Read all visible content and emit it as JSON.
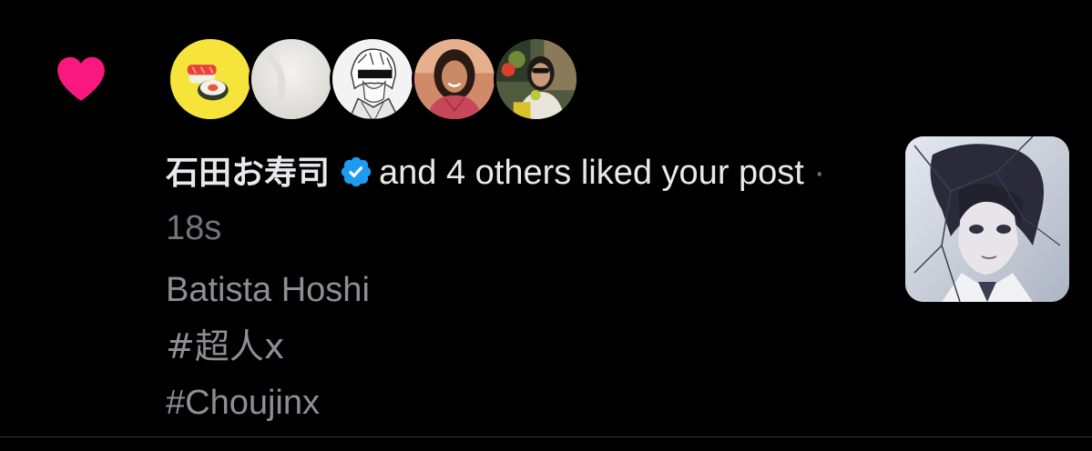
{
  "notification": {
    "type_icon": "heart-icon",
    "accent_color": "#f91880",
    "avatars": [
      {
        "name": "avatar-sushi",
        "icon": "sushi-icon"
      },
      {
        "name": "avatar-blank"
      },
      {
        "name": "avatar-manga-portrait"
      },
      {
        "name": "avatar-woman-smiling"
      },
      {
        "name": "avatar-woman-eating"
      }
    ],
    "actor_name": "石田お寿司",
    "verified_icon": "verified-badge-icon",
    "verified_color": "#1d9bf0",
    "action_text": "and 4 others liked your post",
    "separator": "·",
    "timestamp": "18s",
    "post_lines": [
      "Batista Hoshi",
      "#超人x",
      "#Choujinx"
    ],
    "thumbnail": "post-thumbnail-anime-character"
  }
}
